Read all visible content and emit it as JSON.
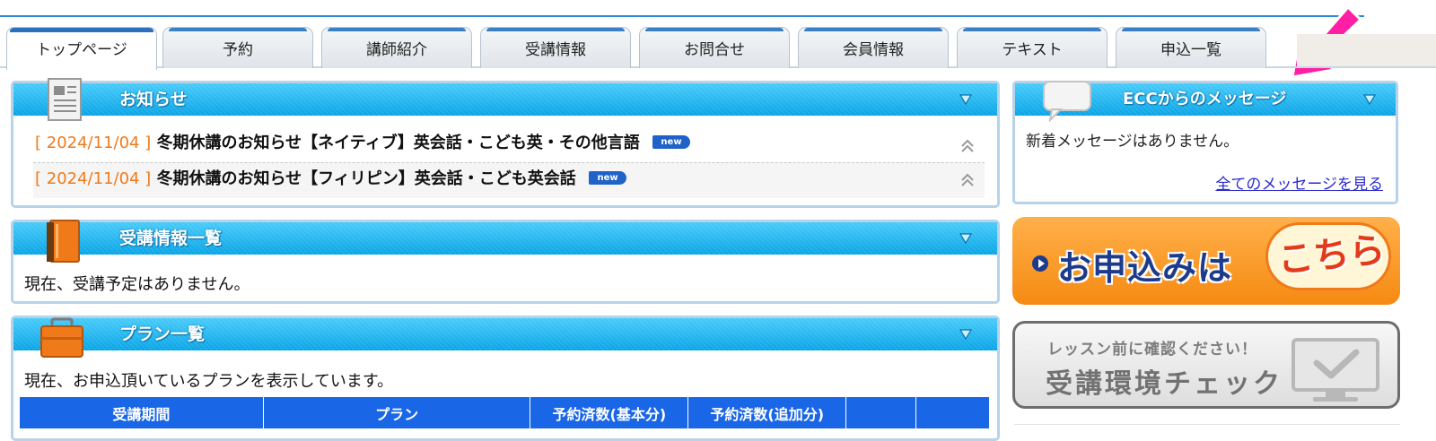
{
  "tabs": [
    {
      "label": "トップページ",
      "active": true
    },
    {
      "label": "予約"
    },
    {
      "label": "講師紹介"
    },
    {
      "label": "受講情報"
    },
    {
      "label": "お問合せ"
    },
    {
      "label": "会員情報"
    },
    {
      "label": "テキスト"
    },
    {
      "label": "申込一覧"
    }
  ],
  "news": {
    "title": "お知らせ",
    "items": [
      {
        "date": "[ 2024/11/04 ]",
        "text": "冬期休講のお知らせ【ネイティブ】英会話・こども英・その他言語",
        "badge": "new"
      },
      {
        "date": "[ 2024/11/04 ]",
        "text": "冬期休講のお知らせ【フィリピン】英会話・こども英会話",
        "badge": "new"
      }
    ]
  },
  "courses": {
    "title": "受講情報一覧",
    "empty_text": "現在、受講予定はありません。"
  },
  "plans": {
    "title": "プラン一覧",
    "intro": "現在、お申込頂いているプランを表示しています。",
    "columns": [
      "受講期間",
      "プラン",
      "予約済数(基本分)",
      "予約済数(追加分)",
      "",
      ""
    ]
  },
  "messages": {
    "title": "ECCからのメッセージ",
    "empty_text": "新着メッセージはありません。",
    "link": "全てのメッセージを見る"
  },
  "apply_banner": {
    "main": "お申込みは",
    "accent": "こちら"
  },
  "check_banner": {
    "small": "レッスン前に確認ください！",
    "big": "受講環境チェック"
  },
  "colors": {
    "header_blue": "#0aa6e8",
    "table_blue": "#1966e6",
    "accent_orange": "#f07a1a",
    "arrow_pink": "#ff1fa4"
  }
}
